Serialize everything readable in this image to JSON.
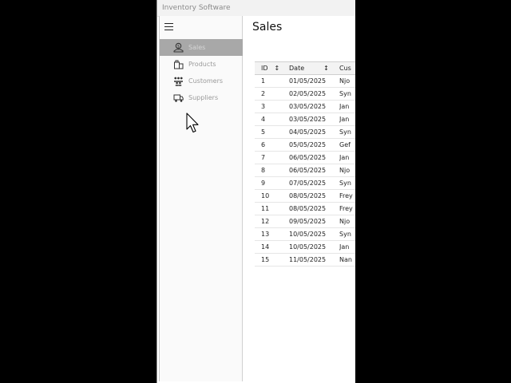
{
  "window": {
    "title": "Inventory Software"
  },
  "sidebar": {
    "items": [
      {
        "label": "Sales",
        "icon": "sales-icon",
        "active": true
      },
      {
        "label": "Products",
        "icon": "products-icon",
        "active": false
      },
      {
        "label": "Customers",
        "icon": "customers-icon",
        "active": false
      },
      {
        "label": "Suppliers",
        "icon": "suppliers-icon",
        "active": false
      }
    ]
  },
  "main": {
    "title": "Sales",
    "table": {
      "columns": [
        "ID",
        "Date",
        "Cus"
      ],
      "rows": [
        [
          "1",
          "01/05/2025",
          "Njo"
        ],
        [
          "2",
          "02/05/2025",
          "Syn"
        ],
        [
          "3",
          "03/05/2025",
          "Jan"
        ],
        [
          "4",
          "03/05/2025",
          "Jan"
        ],
        [
          "5",
          "04/05/2025",
          "Syn"
        ],
        [
          "6",
          "05/05/2025",
          "Gef"
        ],
        [
          "7",
          "06/05/2025",
          "Jan"
        ],
        [
          "8",
          "06/05/2025",
          "Njo"
        ],
        [
          "9",
          "07/05/2025",
          "Syn"
        ],
        [
          "10",
          "08/05/2025",
          "Frey"
        ],
        [
          "11",
          "08/05/2025",
          "Frey"
        ],
        [
          "12",
          "09/05/2025",
          "Njo"
        ],
        [
          "13",
          "10/05/2025",
          "Syn"
        ],
        [
          "14",
          "10/05/2025",
          "Jan"
        ],
        [
          "15",
          "11/05/2025",
          "Nan"
        ]
      ]
    }
  }
}
